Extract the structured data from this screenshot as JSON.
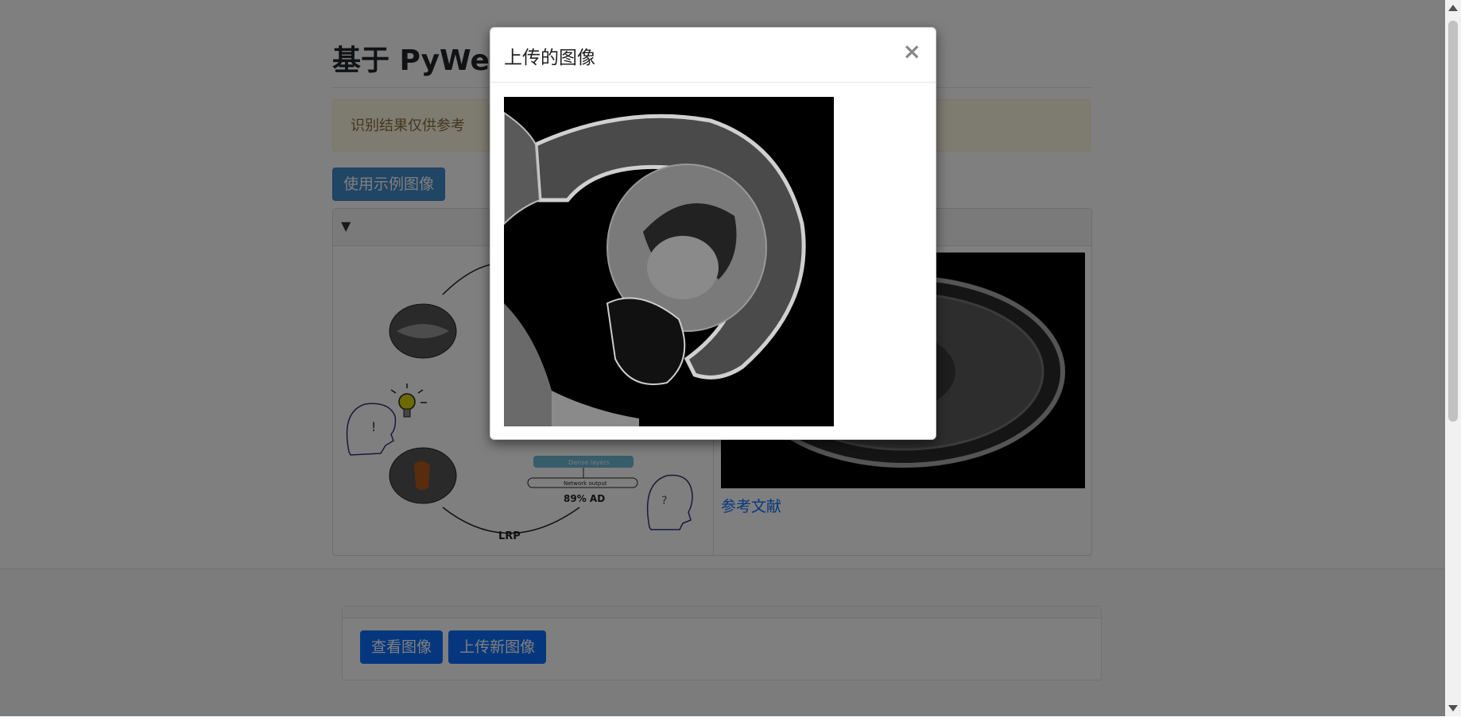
{
  "page": {
    "title": "基于 PyWebIO 的阿尔茨海默病辅助诊断系统",
    "alert_text": "识别结果仅供参考",
    "sample_button": "使用示例图像",
    "panel_toggle": "▼",
    "reference_link": "参考文献",
    "diagram_labels": {
      "lrp": "LRP",
      "output": "89% AD",
      "network_output": "Network output",
      "dense_layers": "Dense layers",
      "exclaim": "!",
      "question": "?"
    }
  },
  "bottom_bar": {
    "view_button": "查看图像",
    "upload_button": "上传新图像"
  },
  "modal": {
    "title": "上传的图像",
    "close_label": "×"
  },
  "colors": {
    "primary": "#428bca",
    "blue": "#0d6efd",
    "alert_bg": "#fcf8e3",
    "alert_text": "#8a6d3b"
  }
}
